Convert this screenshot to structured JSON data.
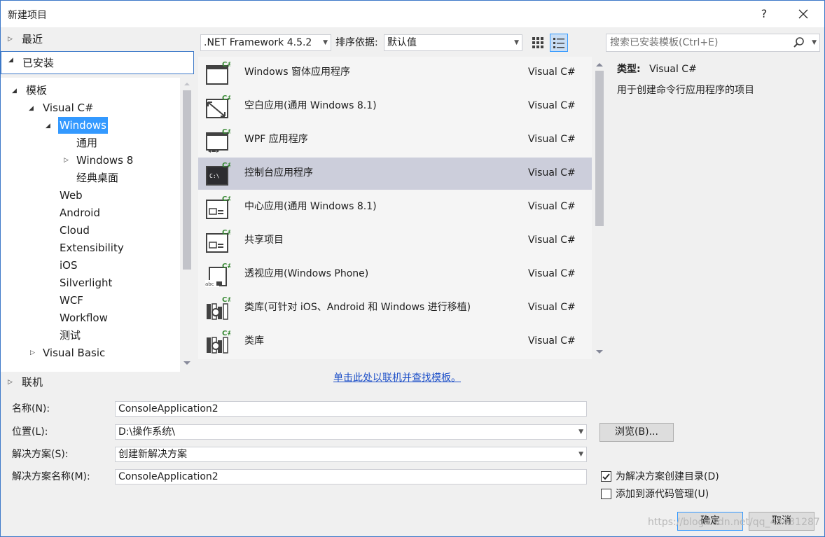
{
  "window": {
    "title": "新建项目",
    "help_label": "?",
    "close_label": "✕"
  },
  "tree": {
    "recent": "最近",
    "installed": "已安装",
    "templates": "模板",
    "visual_csharp": "Visual C#",
    "windows": "Windows",
    "general": "通用",
    "windows8": "Windows 8",
    "classic_desktop": "经典桌面",
    "web": "Web",
    "android": "Android",
    "cloud": "Cloud",
    "extensibility": "Extensibility",
    "ios": "iOS",
    "silverlight": "Silverlight",
    "wcf": "WCF",
    "workflow": "Workflow",
    "test": "测试",
    "visual_basic": "Visual Basic",
    "online": "联机"
  },
  "toolbar": {
    "framework": ".NET Framework 4.5.2",
    "sort_label": "排序依据:",
    "sort_value": "默认值",
    "search_placeholder": "搜索已安装模板(Ctrl+E)"
  },
  "templates": [
    {
      "name": "Windows 窗体应用程序",
      "lang": "Visual C#",
      "icon": "winforms-icon"
    },
    {
      "name": "空白应用(通用 Windows 8.1)",
      "lang": "Visual C#",
      "icon": "blank-app-icon"
    },
    {
      "name": "WPF 应用程序",
      "lang": "Visual C#",
      "icon": "wpf-icon"
    },
    {
      "name": "控制台应用程序",
      "lang": "Visual C#",
      "icon": "console-icon"
    },
    {
      "name": "中心应用(通用 Windows 8.1)",
      "lang": "Visual C#",
      "icon": "hub-app-icon"
    },
    {
      "name": "共享项目",
      "lang": "Visual C#",
      "icon": "shared-project-icon"
    },
    {
      "name": "透视应用(Windows Phone)",
      "lang": "Visual C#",
      "icon": "pivot-app-icon"
    },
    {
      "name": "类库(可针对 iOS、Android 和 Windows 进行移植)",
      "lang": "Visual C#",
      "icon": "portable-library-icon"
    },
    {
      "name": "类库",
      "lang": "Visual C#",
      "icon": "class-library-icon"
    }
  ],
  "details": {
    "type_label": "类型:",
    "type_value": "Visual C#",
    "description": "用于创建命令行应用程序的项目"
  },
  "online_link": "单击此处以联机并查找模板。",
  "form": {
    "name_label": "名称(N):",
    "name_value": "ConsoleApplication2",
    "location_label": "位置(L):",
    "location_value": "D:\\操作系统\\",
    "browse_label": "浏览(B)...",
    "solution_label": "解决方案(S):",
    "solution_value": "创建新解决方案",
    "solution_name_label": "解决方案名称(M):",
    "solution_name_value": "ConsoleApplication2",
    "create_dir_label": "为解决方案创建目录(D)",
    "create_dir_checked": true,
    "add_scc_label": "添加到源代码管理(U)",
    "add_scc_checked": false,
    "ok_label": "确定",
    "cancel_label": "取消"
  },
  "watermark": "https://blog.csdn.net/qq_43431287",
  "colors": {
    "accent": "#3399ff",
    "selected_row": "#cccedb",
    "csharp_green": "#388a34",
    "link": "#1e50c8"
  }
}
